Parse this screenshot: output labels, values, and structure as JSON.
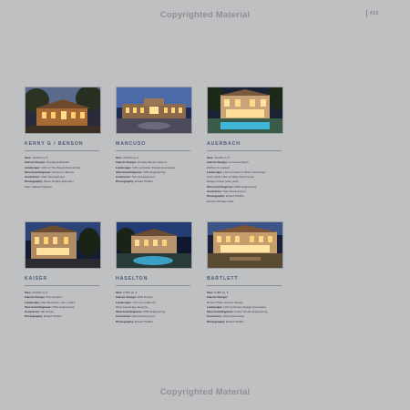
{
  "watermark_top": "Copyrighted Material",
  "watermark_bottom": "Copyrighted Material",
  "page_number": "415",
  "projects": [
    {
      "name": "KENNY G / BENSON",
      "rows": [
        {
          "label": "Size:",
          "value": "18,000 sq. ft."
        },
        {
          "label": "Interior Design:",
          "value": "Friedland-Waddell"
        },
        {
          "label": "Landscape:",
          "value": "LOG w/ The Baugh Partnership"
        },
        {
          "label": "Structural Engineer:",
          "value": "Anderson-Morton"
        },
        {
          "label": "Contractor:",
          "value": "Clark Development"
        },
        {
          "label": "Photography:",
          "value": "Steve Rosling Estimany,"
        },
        {
          "label": "",
          "value": "Marc Valleuli Harianni"
        }
      ]
    },
    {
      "name": "MANCUSO",
      "rows": [
        {
          "label": "Size:",
          "value": "22,000 sq. ft."
        },
        {
          "label": "Interior Design:",
          "value": "Jennifer Bevan Interiors"
        },
        {
          "label": "Landscape:",
          "value": "LOG w/ Zucker Design Associates"
        },
        {
          "label": "Structural Engineer:",
          "value": "RHA Engineering"
        },
        {
          "label": "Contractor:",
          "value": "Tate Development"
        },
        {
          "label": "Photography:",
          "value": "Erhard Pfeiffer"
        }
      ]
    },
    {
      "name": "AUERBACH",
      "rows": [
        {
          "label": "Size:",
          "value": "11,000 sq. ft."
        },
        {
          "label": "Interior Design:",
          "value": "Lorna Auerbach"
        },
        {
          "label": "",
          "value": "(kitchen & master)"
        },
        {
          "label": "Landscape:",
          "value": "LOG w/ Clark & White Landscape"
        },
        {
          "label": "",
          "value": "(front yard) LOG w/ Mark Grant Ivener"
        },
        {
          "label": "",
          "value": "Design Group (rear yard)"
        },
        {
          "label": "Structural Engineer:",
          "value": "RHA Engineering"
        },
        {
          "label": "Contractor:",
          "value": "Tate Development"
        },
        {
          "label": "Photography:",
          "value": "Erhard Pfeiffer,"
        },
        {
          "label": "",
          "value": "Gordon Michael Kelle"
        }
      ]
    },
    {
      "name": "KAISER",
      "rows": [
        {
          "label": "Size:",
          "value": "13,000 sq. ft."
        },
        {
          "label": "Interior Design:",
          "value": "FCI Interiors"
        },
        {
          "label": "Landscape:",
          "value": "Alan Bernstein, AIA + ASLA"
        },
        {
          "label": "Structural Engineer:",
          "value": "RHA Engineering"
        },
        {
          "label": "Contractor:",
          "value": "SD Group"
        },
        {
          "label": "Photography:",
          "value": "Erhard Pfeiffer"
        }
      ]
    },
    {
      "name": "HASELTON",
      "rows": [
        {
          "label": "Size:",
          "value": "8,500 sq. ft."
        },
        {
          "label": "Interior Design:",
          "value": "EPH Design"
        },
        {
          "label": "Landscape:",
          "value": "LOG w/ Landforms"
        },
        {
          "label": "",
          "value": "West Landscape Designs"
        },
        {
          "label": "Structural Engineer:",
          "value": "RHA Engineering"
        },
        {
          "label": "Contractor:",
          "value": "Tate Development"
        },
        {
          "label": "Photography:",
          "value": "Erhard Pfeiffer"
        }
      ]
    },
    {
      "name": "BARTLETT",
      "rows": [
        {
          "label": "Size:",
          "value": "8,000 sq. ft."
        },
        {
          "label": "Interior Design:",
          "value": ""
        },
        {
          "label": "",
          "value": "DeGot Pfeifer Interior Design"
        },
        {
          "label": "Landscape:",
          "value": "LOG w/ Zucker Design Associates"
        },
        {
          "label": "Structural Engineer:",
          "value": "Fedor Vendin Engineering"
        },
        {
          "label": "Contractor:",
          "value": "Pettis Associates"
        },
        {
          "label": "Photography:",
          "value": "Erhard Pfeiffer"
        }
      ]
    }
  ]
}
